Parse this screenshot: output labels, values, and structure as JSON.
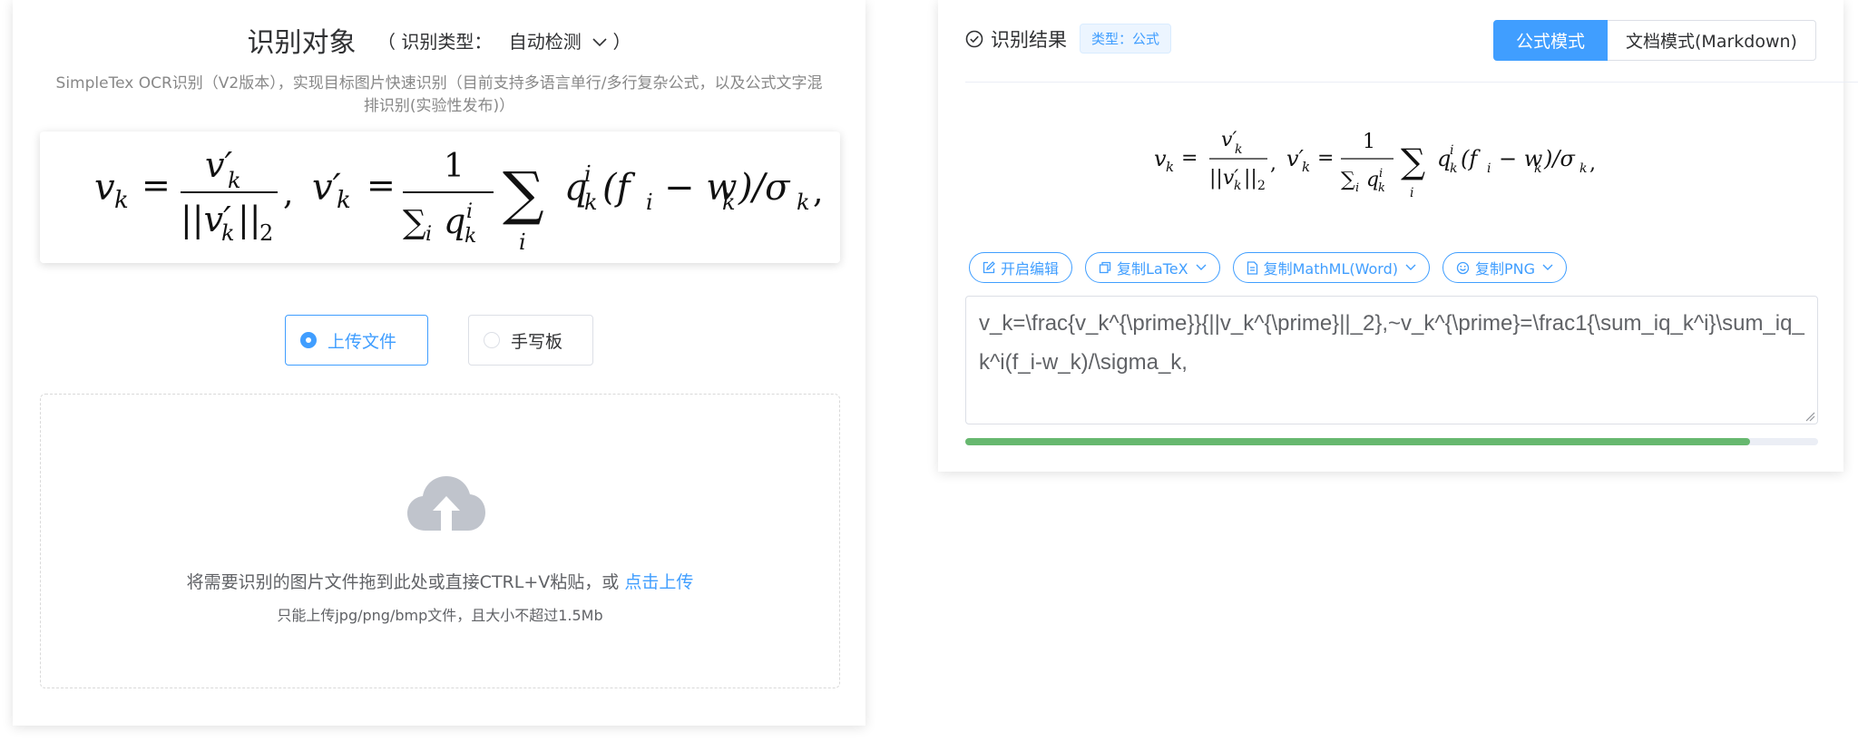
{
  "left": {
    "title": "识别对象",
    "type_label": "（ 识别类型：",
    "type_value": "自动检测",
    "type_close": "）",
    "description": "SimpleTex OCR识别（V2版本），实现目标图片快速识别（目前支持多语言单行/多行复杂公式，以及公式文字混排识别(实验性发布)）",
    "radio_upload": "上传文件",
    "radio_hand": "手写板",
    "drop_text": "将需要识别的图片文件拖到此处或直接CTRL+V粘贴，或",
    "drop_link": "点击上传",
    "drop_tip": "只能上传jpg/png/bmp文件，且大小不超过1.5Mb"
  },
  "formula": {
    "lhs1": "v",
    "sub_k": "k",
    "frac1_num": "v′",
    "frac1_den": "||v′",
    "frac1_den_sub": "2",
    "lhs2": "v′",
    "one": "1",
    "sum_den": "∑",
    "sub_i": "i",
    "q": "q",
    "sup_i": "i",
    "sigma": "∑",
    "tail": "(f",
    "tail2": "− w",
    "tail3": ")/σ",
    "comma": ","
  },
  "right": {
    "title": "识别结果",
    "type_tag": "类型：公式",
    "mode_formula": "公式模式",
    "mode_doc": "文档模式(Markdown)",
    "btn_edit": "开启编辑",
    "btn_latex": "复制LaTeX",
    "btn_mathml": "复制MathML(Word)",
    "btn_png": "复制PNG",
    "latex_text": "v_k=\\frac{v_k^{\\prime}}{||v_k^{\\prime}||_2},~v_k^{\\prime}=\\frac1{\\sum_iq_k^i}\\sum_iq_k^i(f_i-w_k)/\\sigma_k,",
    "progress": 0.92
  },
  "colors": {
    "accent": "#409eff",
    "progress": "#67b86f"
  }
}
